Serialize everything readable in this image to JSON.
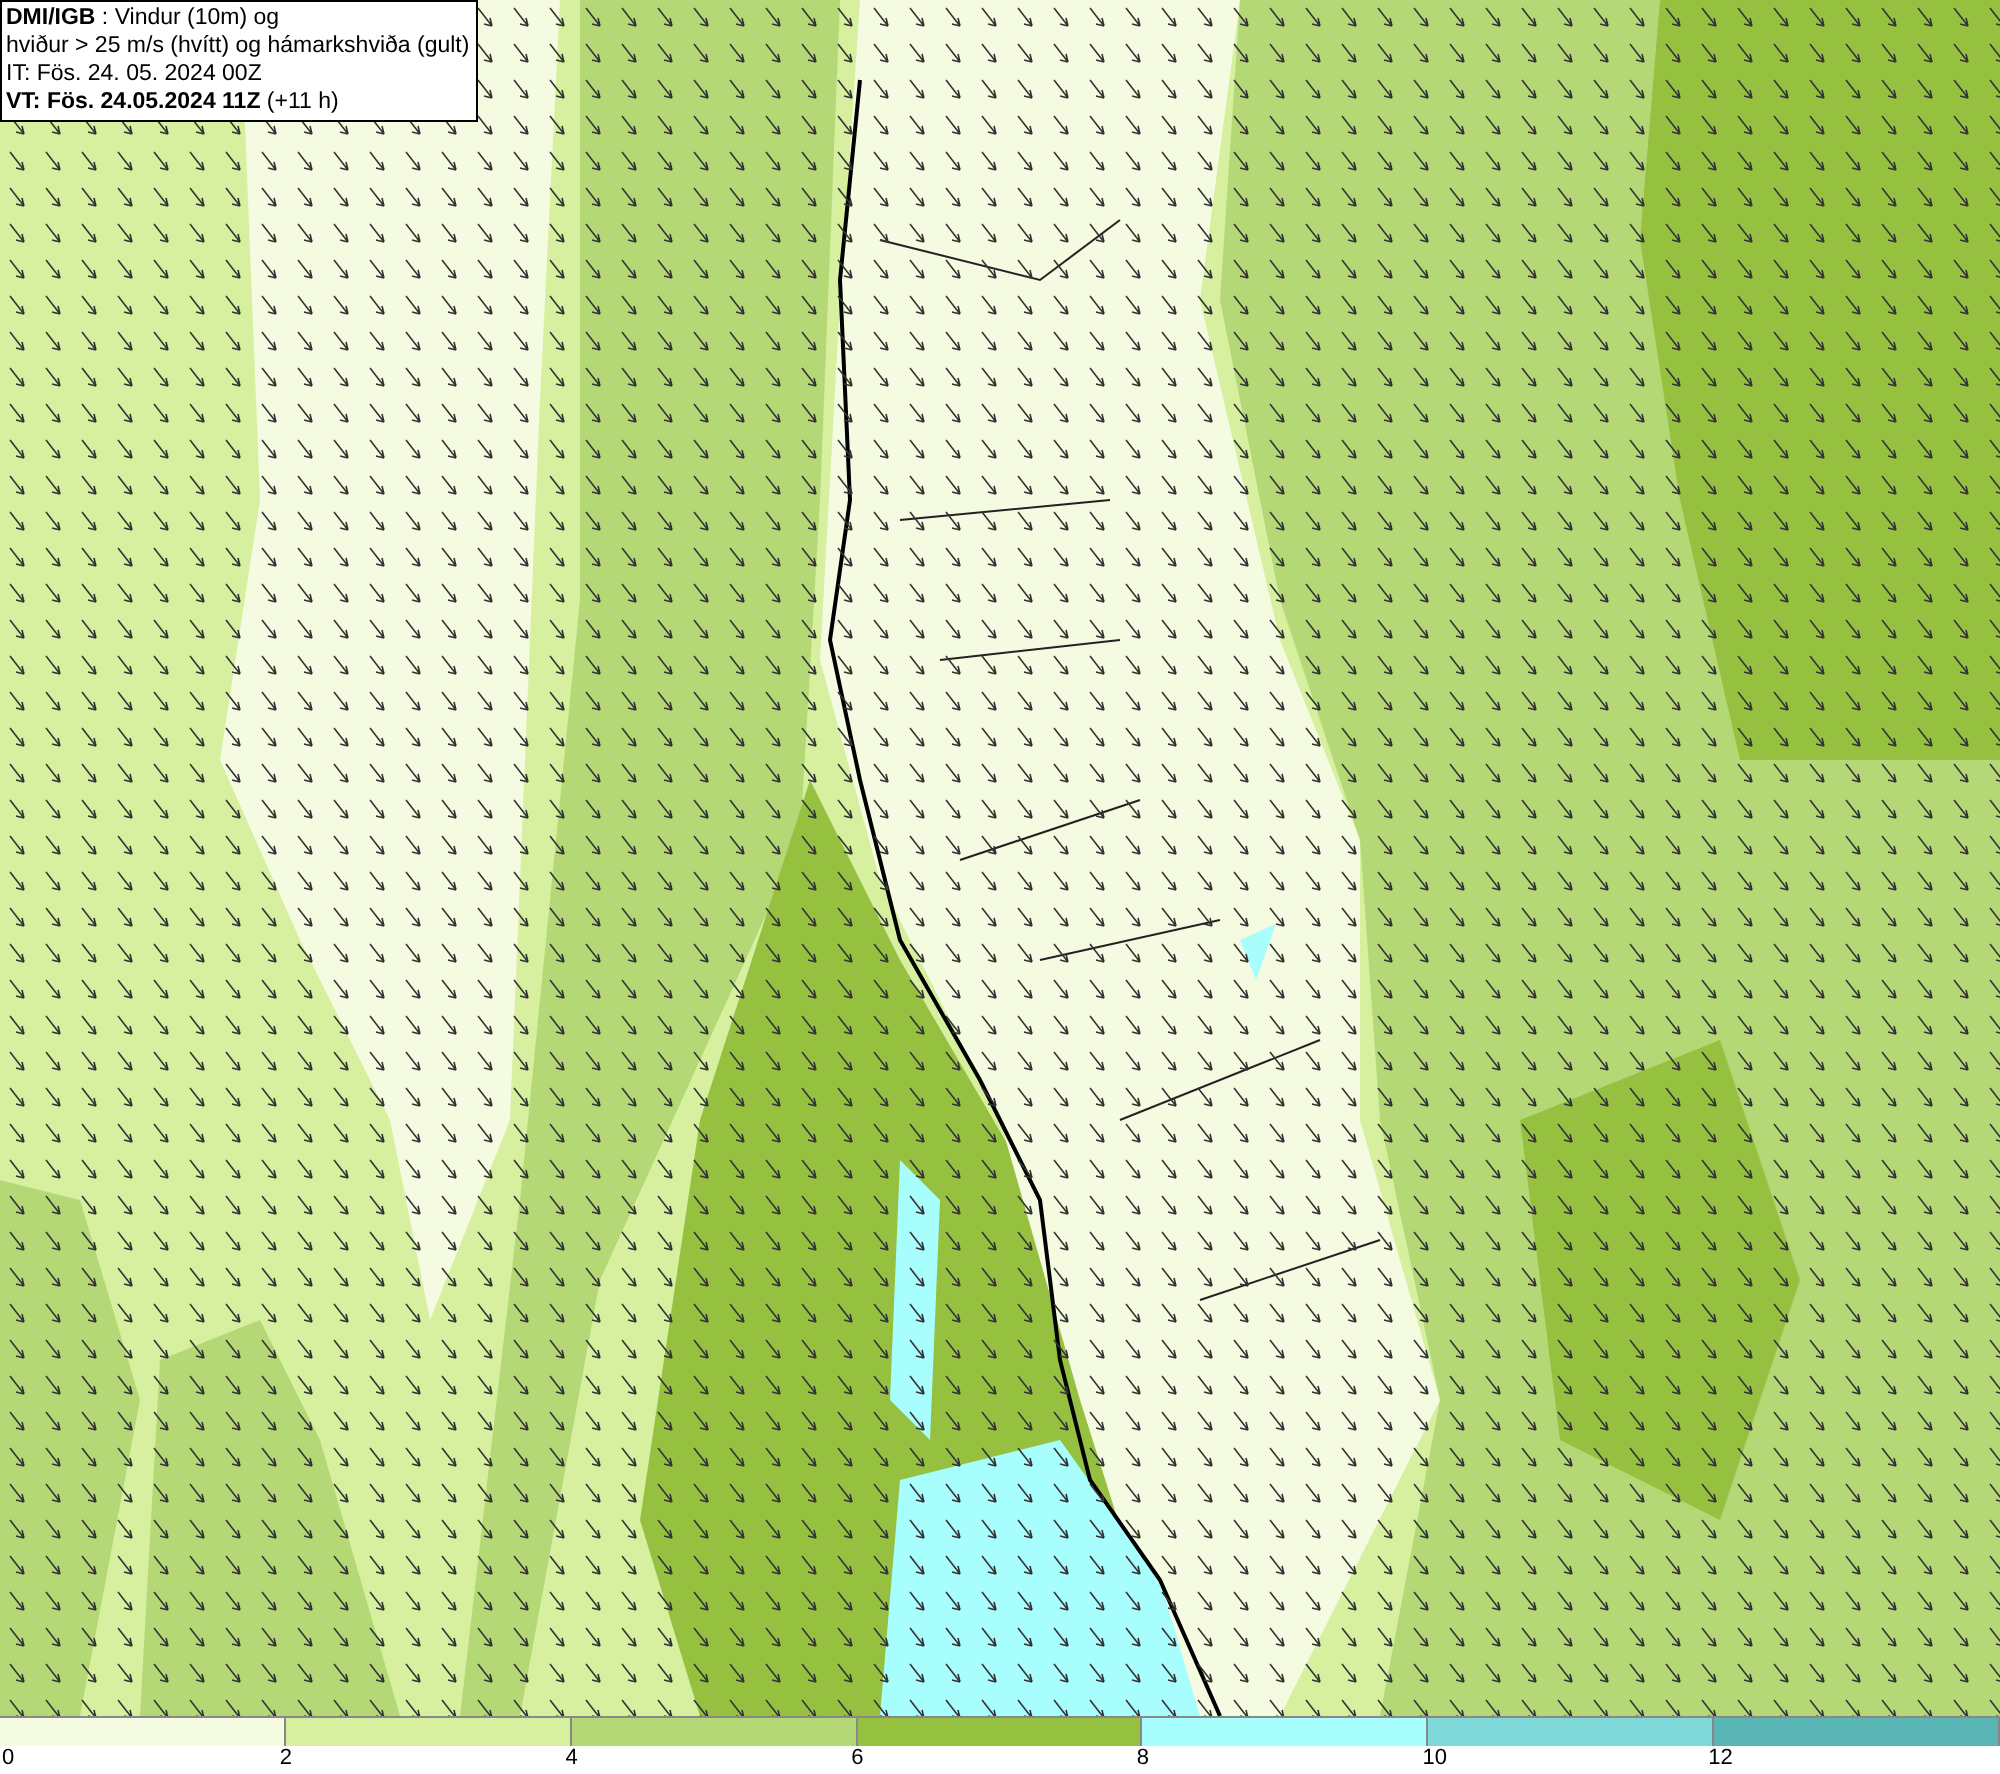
{
  "info_box": {
    "lines": [
      "**DMI/IGB** : Vindur (10m) og",
      "hviður > 25 m/s (hvítt) og hámarkshviða (gult)",
      "IT: Fös. 24. 05. 2024 00Z",
      "**VT: Fös. 24.05.2024 11Z** (+11 h)"
    ]
  },
  "legend": {
    "segments": [
      {
        "color": "#f4fbe0"
      },
      {
        "color": "#d6f0a0"
      },
      {
        "color": "#b5d876"
      },
      {
        "color": "#96c140"
      },
      {
        "color": "#a8fdfd"
      },
      {
        "color": "#7fd8d8"
      },
      {
        "color": "#5ab5b5"
      }
    ],
    "ticks": [
      "0",
      "2",
      "4",
      "6",
      "8",
      "10",
      "12"
    ]
  }
}
